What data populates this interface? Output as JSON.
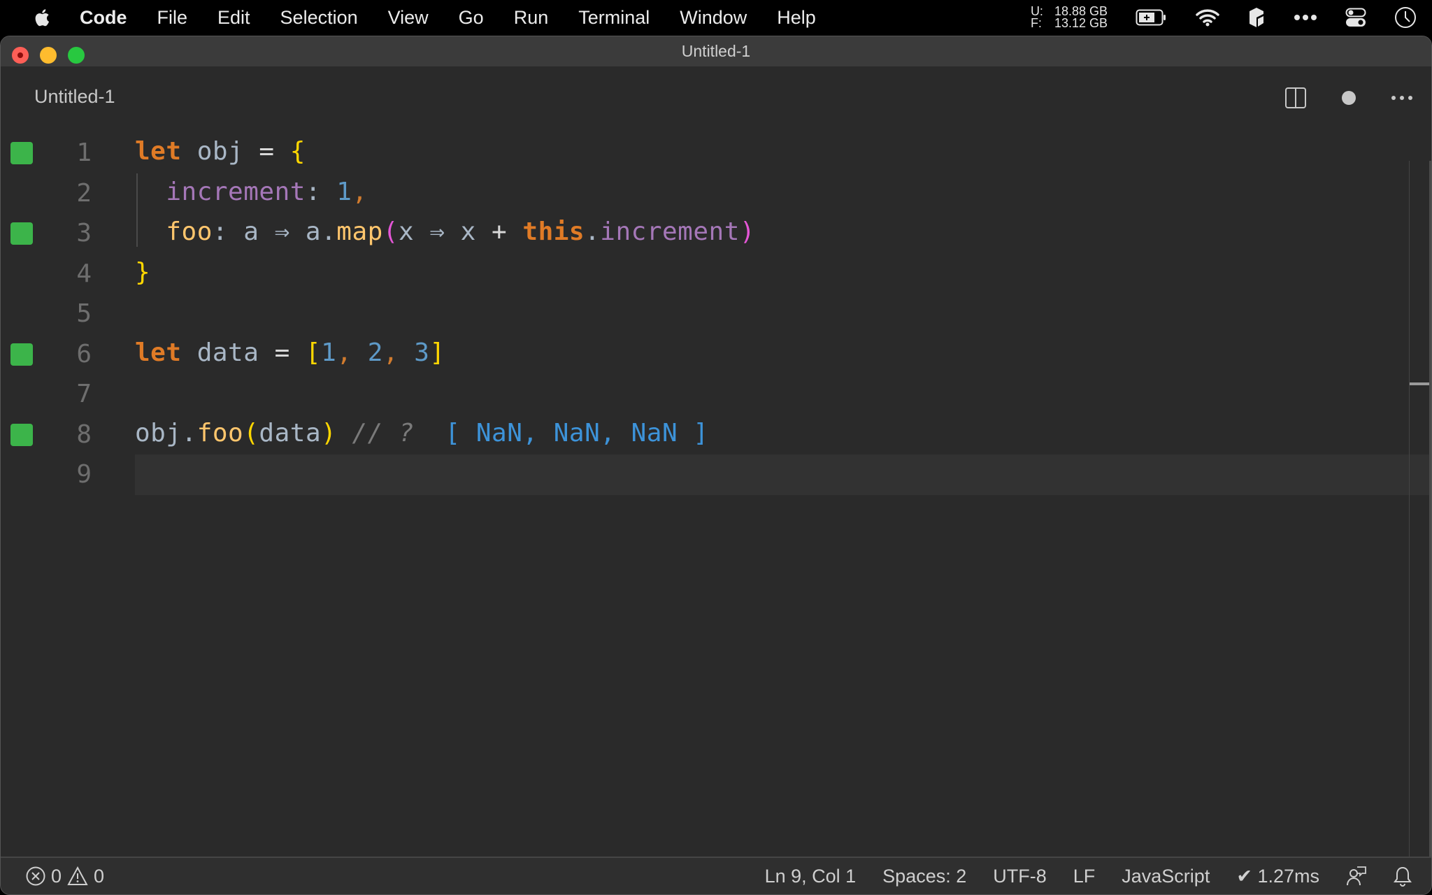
{
  "menubar": {
    "app_name": "Code",
    "items": [
      "File",
      "Edit",
      "Selection",
      "View",
      "Go",
      "Run",
      "Terminal",
      "Window",
      "Help"
    ],
    "memory": {
      "used_label": "U:",
      "used_value": "18.88 GB",
      "free_label": "F:",
      "free_value": "13.12 GB"
    }
  },
  "window": {
    "title": "Untitled-1"
  },
  "tab": {
    "label": "Untitled-1",
    "dirty": true
  },
  "editor": {
    "line_numbers": [
      "1",
      "2",
      "3",
      "4",
      "5",
      "6",
      "7",
      "8",
      "9"
    ],
    "coverage_lines": [
      1,
      3,
      6,
      8
    ],
    "current_line": 9,
    "lines": [
      [
        {
          "t": "let",
          "c": "kw"
        },
        {
          "t": " obj ",
          "c": "var"
        },
        {
          "t": "=",
          "c": "op"
        },
        {
          "t": " ",
          "c": "var"
        },
        {
          "t": "{",
          "c": "brace1"
        }
      ],
      [
        {
          "t": "  increment",
          "c": "prop"
        },
        {
          "t": ":",
          "c": "var"
        },
        {
          "t": " 1",
          "c": "num"
        },
        {
          "t": ",",
          "c": "punc"
        }
      ],
      [
        {
          "t": "  foo",
          "c": "fn"
        },
        {
          "t": ": a ⇒ a.",
          "c": "var"
        },
        {
          "t": "map",
          "c": "fn"
        },
        {
          "t": "(",
          "c": "brace2"
        },
        {
          "t": "x ⇒ x ",
          "c": "var"
        },
        {
          "t": "+",
          "c": "op"
        },
        {
          "t": " ",
          "c": "var"
        },
        {
          "t": "this",
          "c": "kw"
        },
        {
          "t": ".",
          "c": "var"
        },
        {
          "t": "increment",
          "c": "prop"
        },
        {
          "t": ")",
          "c": "brace2"
        }
      ],
      [
        {
          "t": "}",
          "c": "brace1"
        }
      ],
      [],
      [
        {
          "t": "let",
          "c": "kw"
        },
        {
          "t": " data ",
          "c": "var"
        },
        {
          "t": "=",
          "c": "op"
        },
        {
          "t": " ",
          "c": "var"
        },
        {
          "t": "[",
          "c": "brace1"
        },
        {
          "t": "1",
          "c": "num"
        },
        {
          "t": ", ",
          "c": "punc"
        },
        {
          "t": "2",
          "c": "num"
        },
        {
          "t": ", ",
          "c": "punc"
        },
        {
          "t": "3",
          "c": "num"
        },
        {
          "t": "]",
          "c": "brace1"
        }
      ],
      [],
      [
        {
          "t": "obj.",
          "c": "var"
        },
        {
          "t": "foo",
          "c": "fn"
        },
        {
          "t": "(",
          "c": "brace1"
        },
        {
          "t": "data",
          "c": "var"
        },
        {
          "t": ")",
          "c": "brace1"
        },
        {
          "t": " // ?",
          "c": "comment"
        },
        {
          "t": "  [ NaN, NaN, NaN ]",
          "c": "result"
        }
      ],
      []
    ]
  },
  "statusbar": {
    "errors": "0",
    "warnings": "0",
    "cursor": "Ln 9, Col 1",
    "indent": "Spaces: 2",
    "encoding": "UTF-8",
    "eol": "LF",
    "language": "JavaScript",
    "timing": "✔ 1.27ms"
  },
  "colors": {
    "coverage_marker": "#3cb44a",
    "editor_bg": "#2a2a2a",
    "result_text": "#3d93d9"
  }
}
